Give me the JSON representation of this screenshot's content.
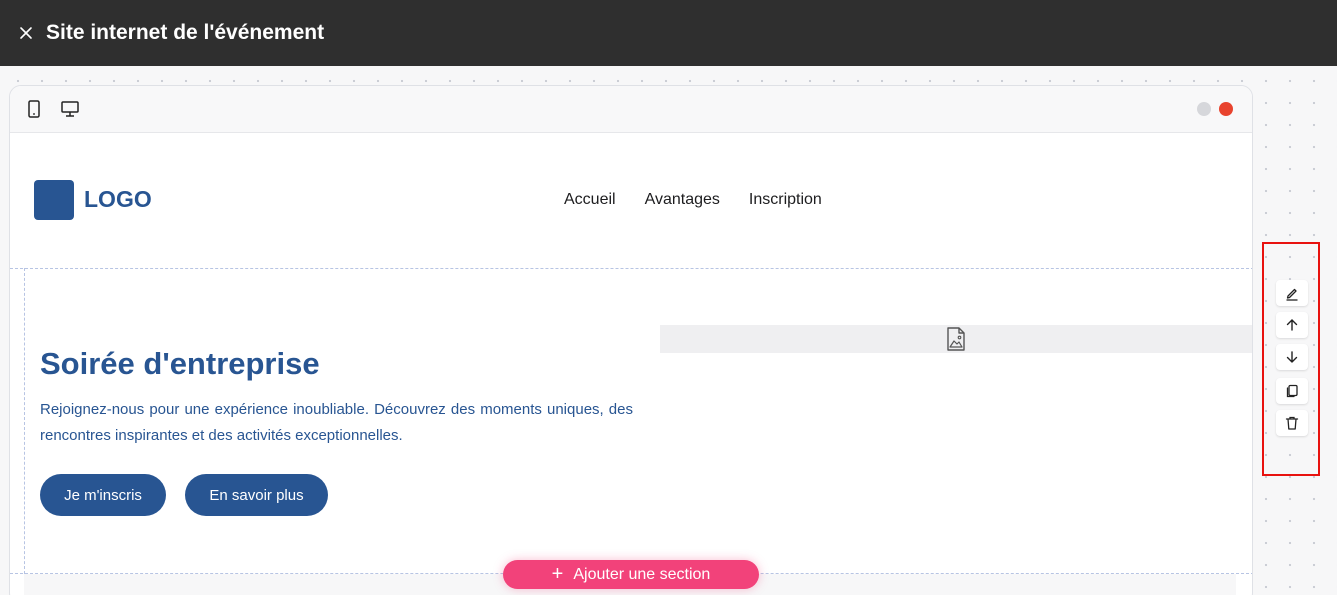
{
  "header": {
    "title": "Site internet de l'événement",
    "close_icon": "close-icon"
  },
  "preview": {
    "device_icons": [
      "mobile-icon",
      "desktop-icon"
    ],
    "window_dots": [
      "#d6d7db",
      "#e8432e"
    ]
  },
  "site": {
    "logo_text": "LOGO",
    "nav": [
      "Accueil",
      "Avantages",
      "Inscription"
    ],
    "hero": {
      "title": "Soirée d'entreprise",
      "description": "Rejoignez-nous pour une expérience inoubliable. Découvrez des moments uniques, des rencontres inspirantes et des activités exceptionnelles.",
      "primary_button": "Je m'inscris",
      "secondary_button": "En savoir plus",
      "image_icon": "image-placeholder-icon"
    }
  },
  "add_section": {
    "label": "Ajouter une section",
    "icon": "plus-icon"
  },
  "section_actions": [
    "edit-icon",
    "arrow-up-icon",
    "arrow-down-icon",
    "duplicate-icon",
    "trash-icon"
  ],
  "colors": {
    "brand_blue": "#285592",
    "accent_pink": "#f2427a",
    "topbar": "#2f2f2f",
    "highlight_red": "#e8120f"
  }
}
